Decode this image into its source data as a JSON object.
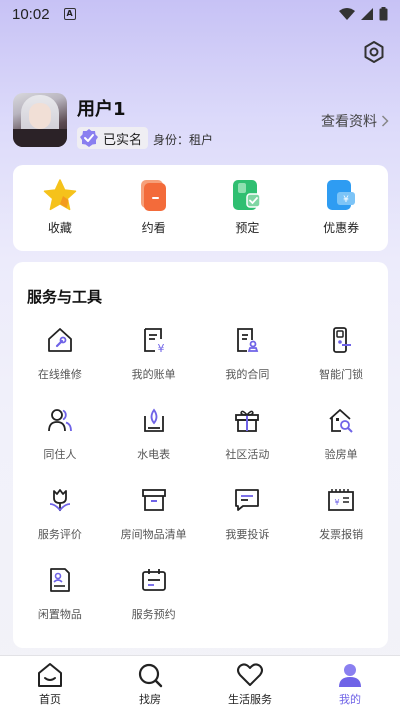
{
  "status": {
    "time": "10:02",
    "indicator": "A"
  },
  "profile": {
    "username": "用户1",
    "verified_label": "已实名",
    "identity_label": "身份：租户",
    "view_profile_label": "查看资料"
  },
  "quick_actions": [
    {
      "label": "收藏",
      "icon": "star-icon"
    },
    {
      "label": "约看",
      "icon": "phone-card-icon"
    },
    {
      "label": "预定",
      "icon": "booking-icon"
    },
    {
      "label": "优惠券",
      "icon": "coupon-icon"
    }
  ],
  "services": {
    "title": "服务与工具",
    "items": [
      {
        "label": "在线维修",
        "icon": "repair-house-icon"
      },
      {
        "label": "我的账单",
        "icon": "bill-icon"
      },
      {
        "label": "我的合同",
        "icon": "contract-icon"
      },
      {
        "label": "智能门锁",
        "icon": "smart-lock-icon"
      },
      {
        "label": "同住人",
        "icon": "roommates-icon"
      },
      {
        "label": "水电表",
        "icon": "water-meter-icon"
      },
      {
        "label": "社区活动",
        "icon": "gift-icon"
      },
      {
        "label": "验房单",
        "icon": "inspection-icon"
      },
      {
        "label": "服务评价",
        "icon": "flower-icon"
      },
      {
        "label": "房间物品清单",
        "icon": "box-icon"
      },
      {
        "label": "我要投诉",
        "icon": "chat-icon"
      },
      {
        "label": "发票报销",
        "icon": "invoice-icon"
      },
      {
        "label": "闲置物品",
        "icon": "document-person-icon"
      },
      {
        "label": "服务预约",
        "icon": "calendar-icon"
      }
    ]
  },
  "tabs": [
    {
      "label": "首页",
      "icon": "home-icon",
      "active": false
    },
    {
      "label": "找房",
      "icon": "search-icon",
      "active": false
    },
    {
      "label": "生活服务",
      "icon": "heart-icon",
      "active": false
    },
    {
      "label": "我的",
      "icon": "user-icon",
      "active": true
    }
  ],
  "colors": {
    "accent": "#6f63e7",
    "star": "#f5c21b",
    "orange": "#f36b3a",
    "green": "#2fbf71",
    "blue": "#2e9cf2"
  }
}
